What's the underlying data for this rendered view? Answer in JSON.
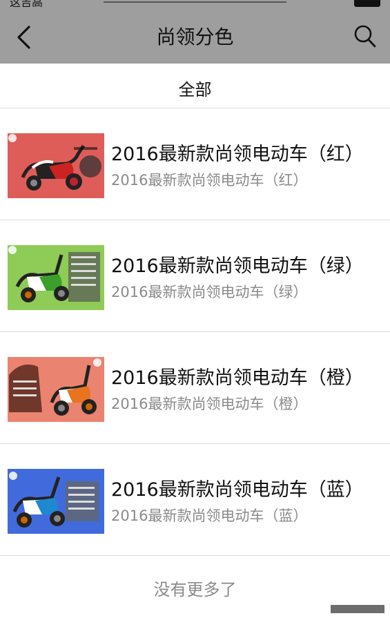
{
  "status_bar": {
    "carrier": "这吉高"
  },
  "nav": {
    "title": "尚领分色",
    "back_icon": "chevron-left-icon",
    "search_icon": "search-icon"
  },
  "filter": {
    "label": "全部"
  },
  "items": [
    {
      "title": "2016最新款尚领电动车（红）",
      "subtitle": "2016最新款尚领电动车（红）",
      "thumb_color": "#d83a35",
      "scooter_color": "#cc2222"
    },
    {
      "title": "2016最新款尚领电动车（绿）",
      "subtitle": "2016最新款尚领电动车（绿）",
      "thumb_color": "#7cc23a",
      "scooter_color": "#3aa02a"
    },
    {
      "title": "2016最新款尚领电动车（橙）",
      "subtitle": "2016最新款尚领电动车（橙）",
      "thumb_color": "#e45a42",
      "scooter_color": "#e8741e"
    },
    {
      "title": "2016最新款尚领电动车（蓝）",
      "subtitle": "2016最新款尚领电动车（蓝）",
      "thumb_color": "#2c5bd8",
      "scooter_color": "#1e88d0"
    }
  ],
  "footer": {
    "no_more_label": "没有更多了"
  }
}
